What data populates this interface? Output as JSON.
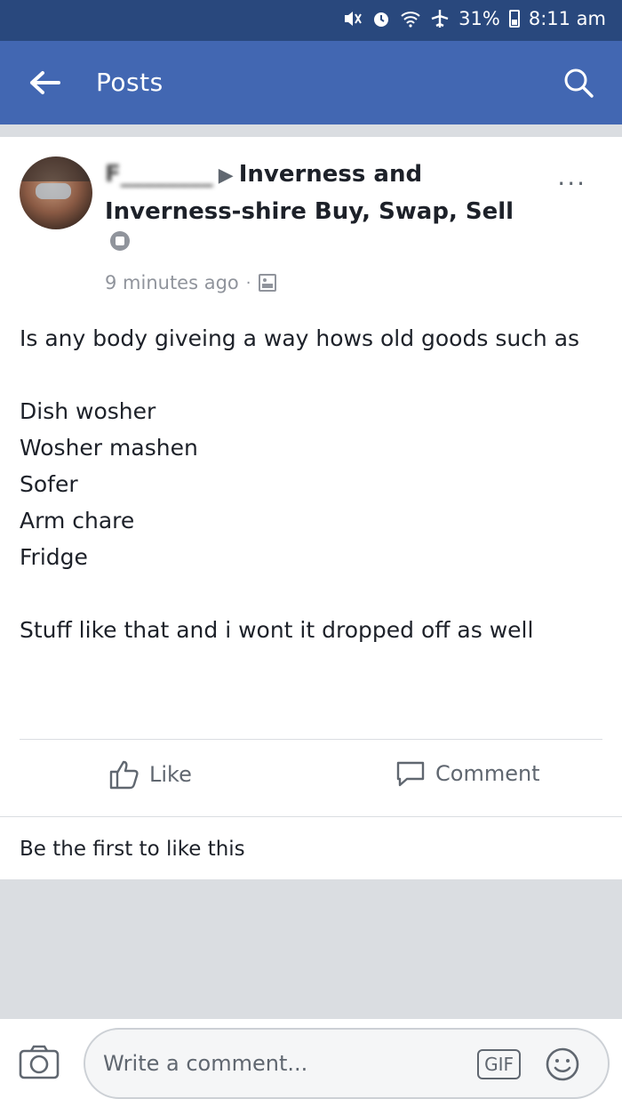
{
  "status_bar": {
    "battery_percent": "31%",
    "time": "8:11 am",
    "icons": [
      "mute-icon",
      "alarm-icon",
      "wifi-icon",
      "airplane-icon",
      "battery-icon"
    ]
  },
  "app_bar": {
    "title": "Posts",
    "icons": [
      "back-arrow-icon",
      "search-icon"
    ],
    "color": "#4267b2"
  },
  "post": {
    "author": "F________",
    "group": "Inverness and Inverness-shire Buy, Swap, Sell",
    "time": "9 minutes ago",
    "meta_separator": "·",
    "more_label": "...",
    "body_lines": [
      "Is any body giveing a way hows old goods such as",
      "",
      "Dish wosher",
      "Wosher mashen",
      "Sofer",
      "Arm chare",
      "Fridge",
      "",
      "Stuff like that and i wont it dropped off as well"
    ],
    "actions": {
      "like_label": "Like",
      "comment_label": "Comment"
    },
    "likes_summary": "Be the first to like this"
  },
  "composer": {
    "placeholder": "Write a comment...",
    "gif_label": "GIF",
    "icons": [
      "camera-icon",
      "emoji-icon"
    ]
  }
}
